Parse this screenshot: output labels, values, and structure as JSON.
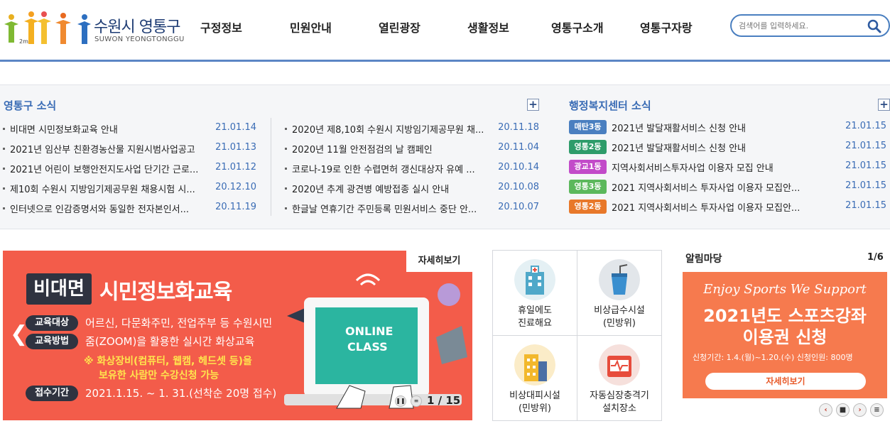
{
  "header": {
    "logo_ko": "수원시 영통구",
    "logo_en": "SUWON YEONGTONGGU",
    "logo_tag": "2m",
    "nav": [
      "구정정보",
      "민원안내",
      "열린광장",
      "생활정보",
      "영통구소개",
      "영통구자랑"
    ],
    "search_placeholder": "검색어를 입력하세요."
  },
  "news": {
    "title": "영통구 소식",
    "col1": [
      {
        "title": "비대면 시민정보화교육 안내",
        "date": "21.01.14"
      },
      {
        "title": "2021년 임산부 친환경농산물 지원시범사업공고",
        "date": "21.01.13"
      },
      {
        "title": "2021년 어린이 보행안전지도사업 단기간 근로...",
        "date": "21.01.12"
      },
      {
        "title": "제10회 수원시 지방임기제공무원 채용시험 시...",
        "date": "20.12.10"
      },
      {
        "title": "인터넷으로 인감증명서와 동일한 전자본인서...",
        "date": "20.11.19"
      }
    ],
    "col2": [
      {
        "title": "2020년 제8,10회 수원시 지방임기제공무원 채...",
        "date": "20.11.18"
      },
      {
        "title": "2020년 11월 안전점검의 날 캠페인",
        "date": "20.11.04"
      },
      {
        "title": "코로나-19로 인한 수렵면허 갱신대상자 유예 ...",
        "date": "20.10.14"
      },
      {
        "title": "2020년 추계 광견병 예방접종 실시 안내",
        "date": "20.10.08"
      },
      {
        "title": "한글날 연휴기간 주민등록 민원서비스 중단 안...",
        "date": "20.10.07"
      }
    ]
  },
  "center": {
    "title": "행정복지센터 소식",
    "items": [
      {
        "badge": "매탄3동",
        "color": "#4a7fc0",
        "title": "2021년 발달재활서비스 신청 안내",
        "date": "21.01.15"
      },
      {
        "badge": "영통2동",
        "color": "#2e9c6a",
        "title": "2021년 발달재활서비스 신청 안내",
        "date": "21.01.15"
      },
      {
        "badge": "광교1동",
        "color": "#c24bc9",
        "title": "지역사회서비스투자사업 이용자 모집 안내",
        "date": "21.01.15"
      },
      {
        "badge": "영통3동",
        "color": "#5cb85c",
        "title": "2021 지역사회서비스 투자사업 이용자 모집안...",
        "date": "21.01.15"
      },
      {
        "badge": "영통2동",
        "color": "#e8782a",
        "title": "2021 지역사회서비스 투자사업 이용자 모집안...",
        "date": "21.01.15"
      }
    ]
  },
  "banner": {
    "detail": "자세히보기",
    "title_box": "비대면",
    "title_rest": "시민정보화교육",
    "label1": "교육대상",
    "text1": "어르신, 다문화주민, 전업주부 등 수원시민",
    "label2": "교육방법",
    "text2": "줌(ZOOM)을 활용한 실시간 화상교육",
    "yellow1": "※ 화상장비(컴퓨터, 웹캠, 헤드셋 등)을",
    "yellow2": "보유한 사람만 수강신청 가능",
    "label3": "접수기간",
    "text3": "2021.1.15. ~ 1. 31.(선착순 20명 접수)",
    "screen_line1": "ONLINE",
    "screen_line2": "CLASS",
    "pager": "1 / 15"
  },
  "quick": [
    {
      "line1": "휴일에도",
      "line2": "진료해요"
    },
    {
      "line1": "비상급수시설",
      "line2": "(민방위)"
    },
    {
      "line1": "비상대피시설",
      "line2": "(민방위)"
    },
    {
      "line1": "자동심장충격기",
      "line2": "설치장소"
    }
  ],
  "notice": {
    "title": "알림마당",
    "page": "1/6",
    "script": "Enjoy Sports We Support",
    "title1": "2021년도 스포츠강좌",
    "title2": "이용권 신청",
    "period": "신청기간: 1.4.(월)~1.20.(수)  신청인원: 800명",
    "button": "자세히보기"
  }
}
